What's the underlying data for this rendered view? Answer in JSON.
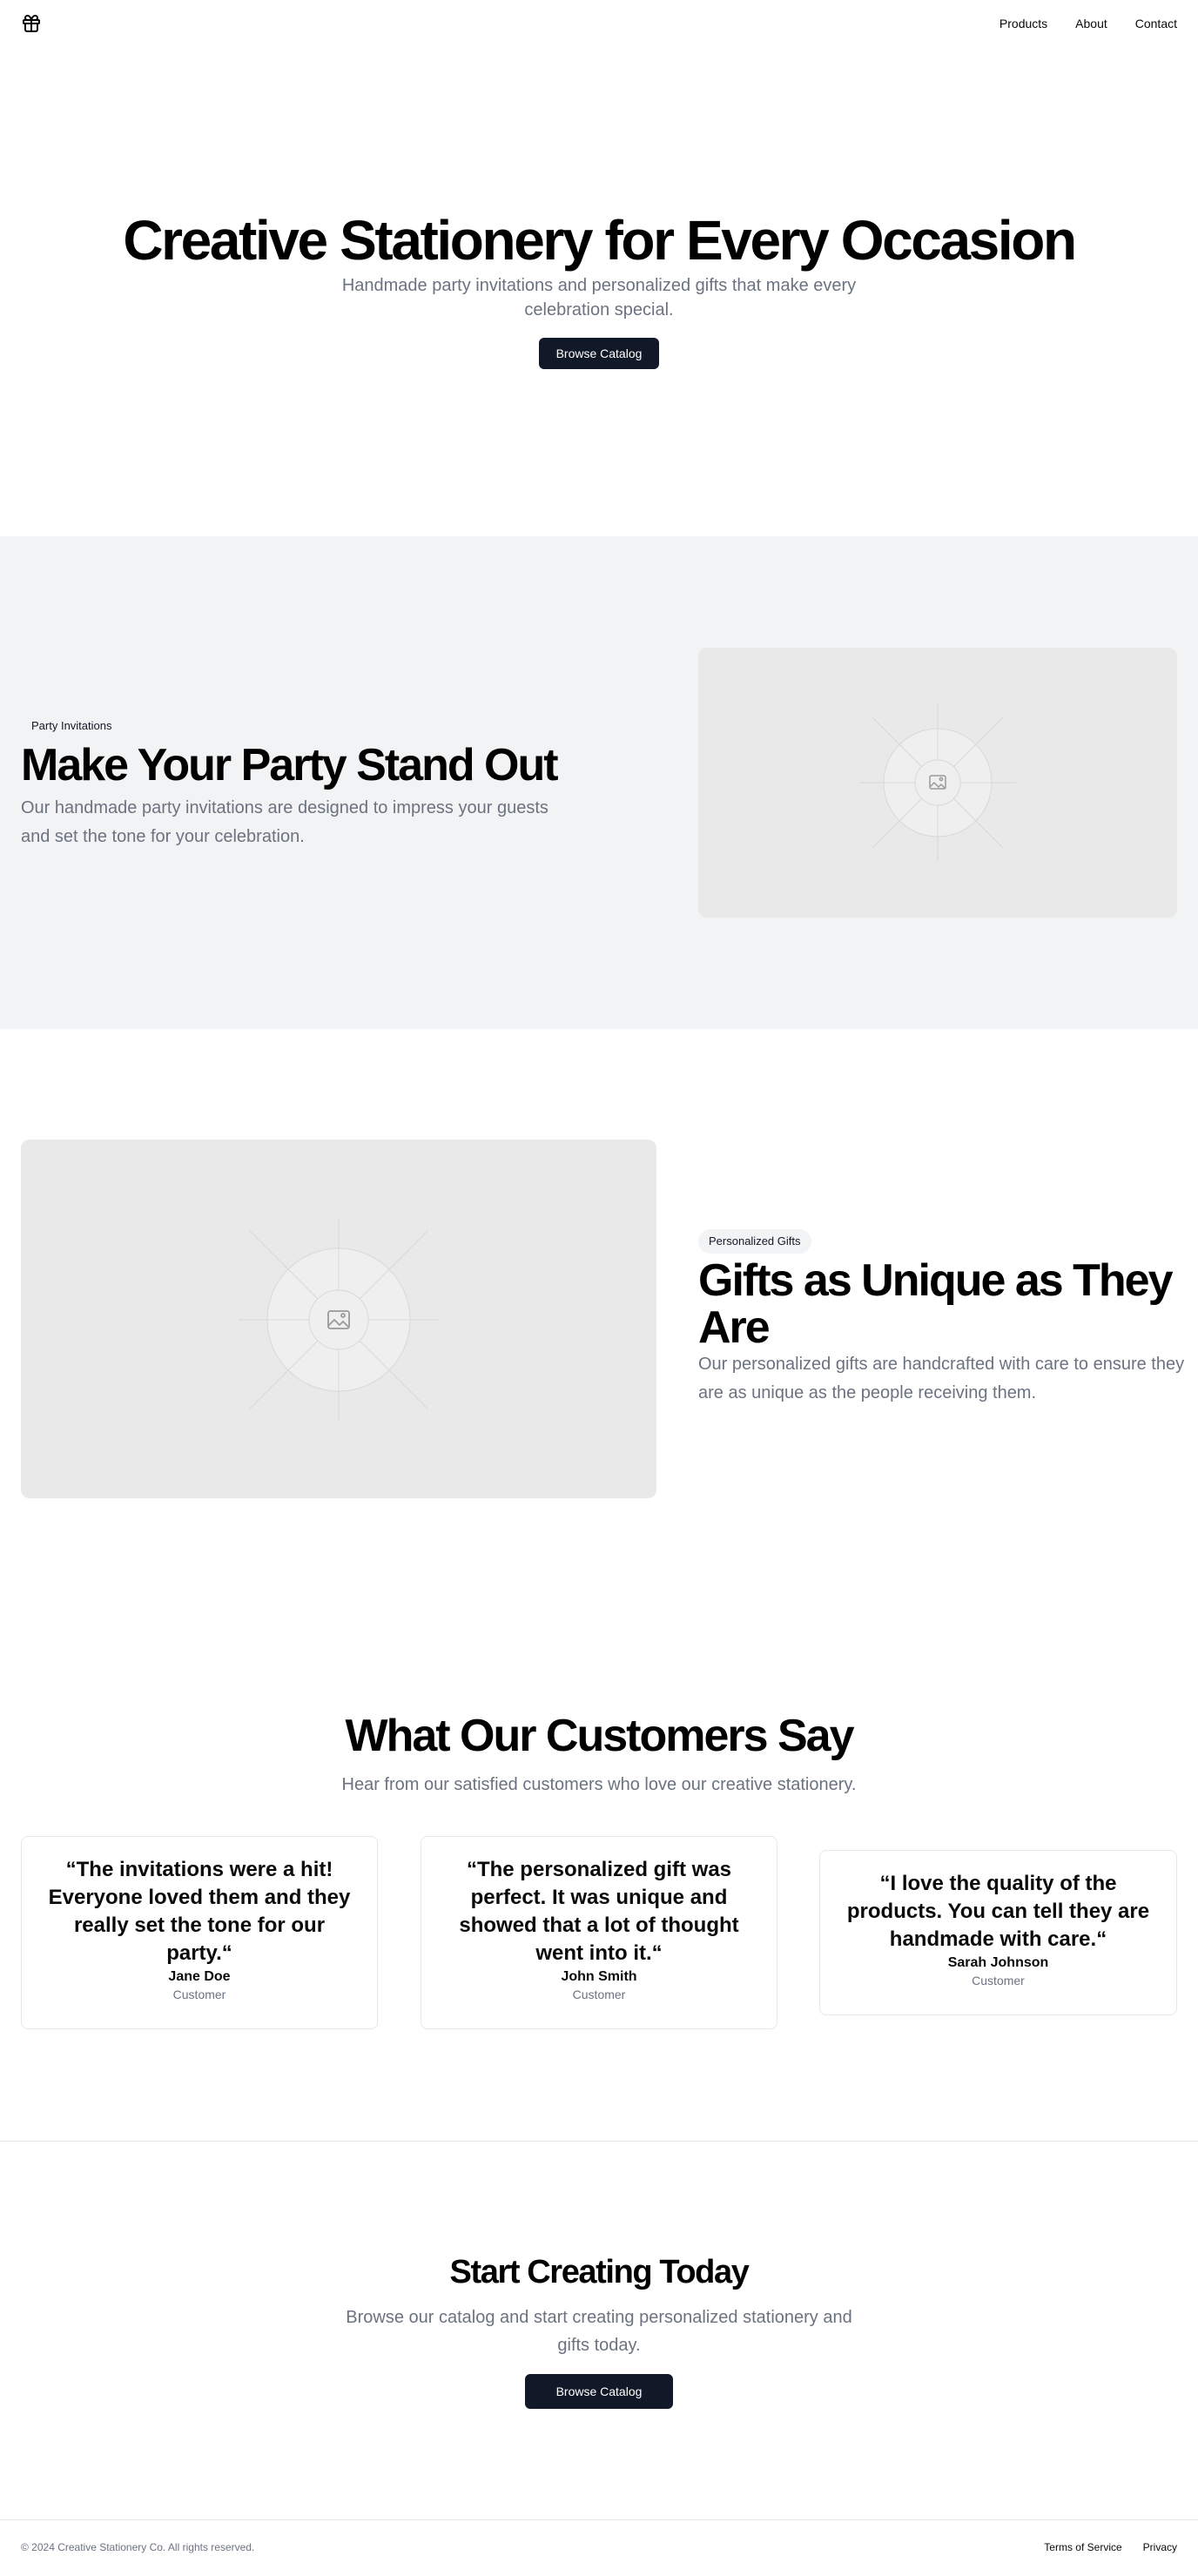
{
  "header": {
    "logo_icon": "gift-icon",
    "nav": [
      {
        "label": "Products"
      },
      {
        "label": "About"
      },
      {
        "label": "Contact"
      }
    ]
  },
  "hero": {
    "title": "Creative Stationery for Every Occasion",
    "subtitle": "Handmade party invitations and personalized gifts that make every celebration special.",
    "button": "Browse Catalog"
  },
  "features": [
    {
      "badge": "Party Invitations",
      "title": "Make Your Party Stand Out",
      "description": "Our handmade party invitations are designed to impress your guests and set the tone for your celebration.",
      "image_icon": "image-placeholder-icon"
    },
    {
      "badge": "Personalized Gifts",
      "title": "Gifts as Unique as They Are",
      "description": "Our personalized gifts are handcrafted with care to ensure they are as unique as the people receiving them.",
      "image_icon": "image-placeholder-icon"
    }
  ],
  "testimonials": {
    "title": "What Our Customers Say",
    "subtitle": "Hear from our satisfied customers who love our creative stationery.",
    "items": [
      {
        "quote": "“The invitations were a hit! Everyone loved them and they really set the tone for our party.“",
        "name": "Jane Doe",
        "role": "Customer"
      },
      {
        "quote": "“The personalized gift was perfect. It was unique and showed that a lot of thought went into it.“",
        "name": "John Smith",
        "role": "Customer"
      },
      {
        "quote": "“I love the quality of the products. You can tell they are handmade with care.“",
        "name": "Sarah Johnson",
        "role": "Customer"
      }
    ]
  },
  "cta": {
    "title": "Start Creating Today",
    "subtitle": "Browse our catalog and start creating personalized stationery and gifts today.",
    "button": "Browse Catalog"
  },
  "footer": {
    "copyright": "© 2024 Creative Stationery Co. All rights reserved.",
    "links": [
      {
        "label": "Terms of Service"
      },
      {
        "label": "Privacy"
      }
    ]
  },
  "colors": {
    "primary_button": "#111827",
    "muted_text": "#6b7280",
    "section_bg": "#f2f3f4",
    "placeholder_bg": "#e9e9e9"
  }
}
